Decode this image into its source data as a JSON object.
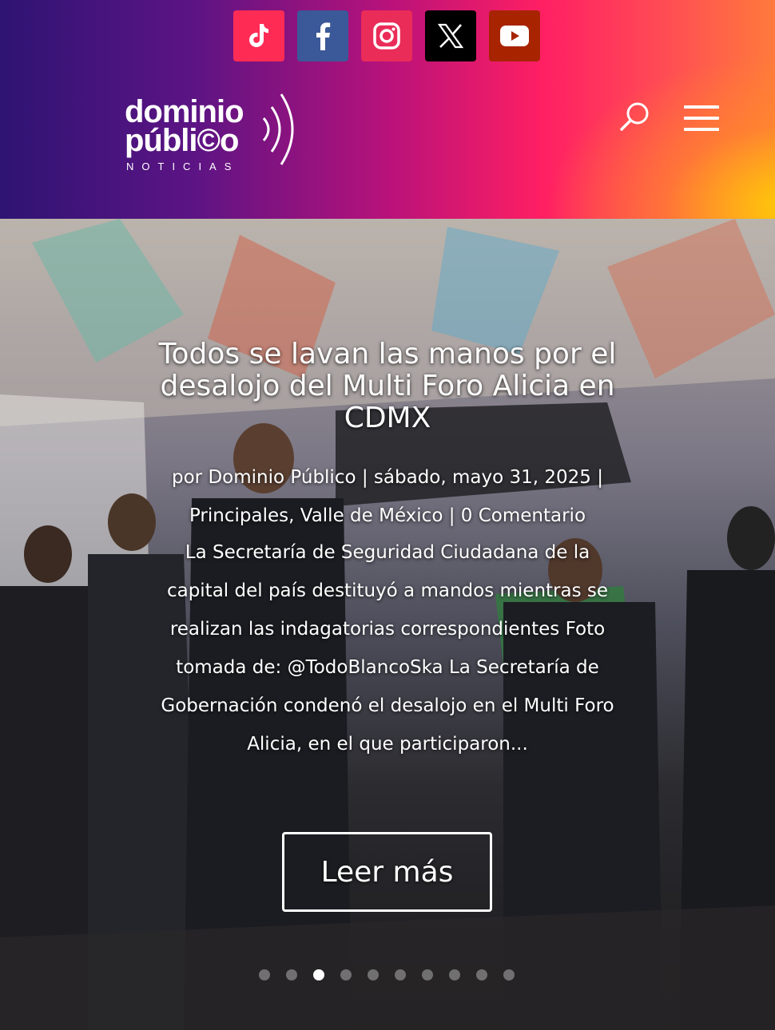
{
  "social": [
    {
      "name": "tiktok",
      "icon": "tiktok-icon",
      "color": "#fe2c55"
    },
    {
      "name": "facebook",
      "icon": "facebook-icon",
      "color": "#3b5998"
    },
    {
      "name": "instagram",
      "icon": "instagram-icon",
      "color": "#ea2c59"
    },
    {
      "name": "x",
      "icon": "x-icon",
      "color": "#000000"
    },
    {
      "name": "youtube",
      "icon": "youtube-icon",
      "color": "#a82400"
    }
  ],
  "logo": {
    "line1": "dominio",
    "line2": "públi©o",
    "line3": "NOTICIAS"
  },
  "header_icons": {
    "search": "search-icon",
    "menu": "hamburger-menu-icon"
  },
  "slide": {
    "title": "Todos se lavan las manos por el desalojo del Multi Foro Alicia en CDMX",
    "meta": {
      "by": "por",
      "author": "Dominio Público",
      "sep1": "|",
      "date": "sábado, mayo 31, 2025",
      "sep2": "|",
      "category1": "Principales",
      "comma": ",",
      "category2": "Valle de México",
      "sep3": "|",
      "comments": "0 Comentario"
    },
    "excerpt": "La Secretaría de Seguridad Ciudadana de la capital del país destituyó a mandos mientras se realizan las indagatorias correspondientes Foto tomada de: @TodoBlancoSka La Secretaría de Gobernación condenó el desalojo en el Multi Foro Alicia, en el que participaron...",
    "button": "Leer más"
  },
  "slider": {
    "total": 10,
    "active_index": 2
  }
}
